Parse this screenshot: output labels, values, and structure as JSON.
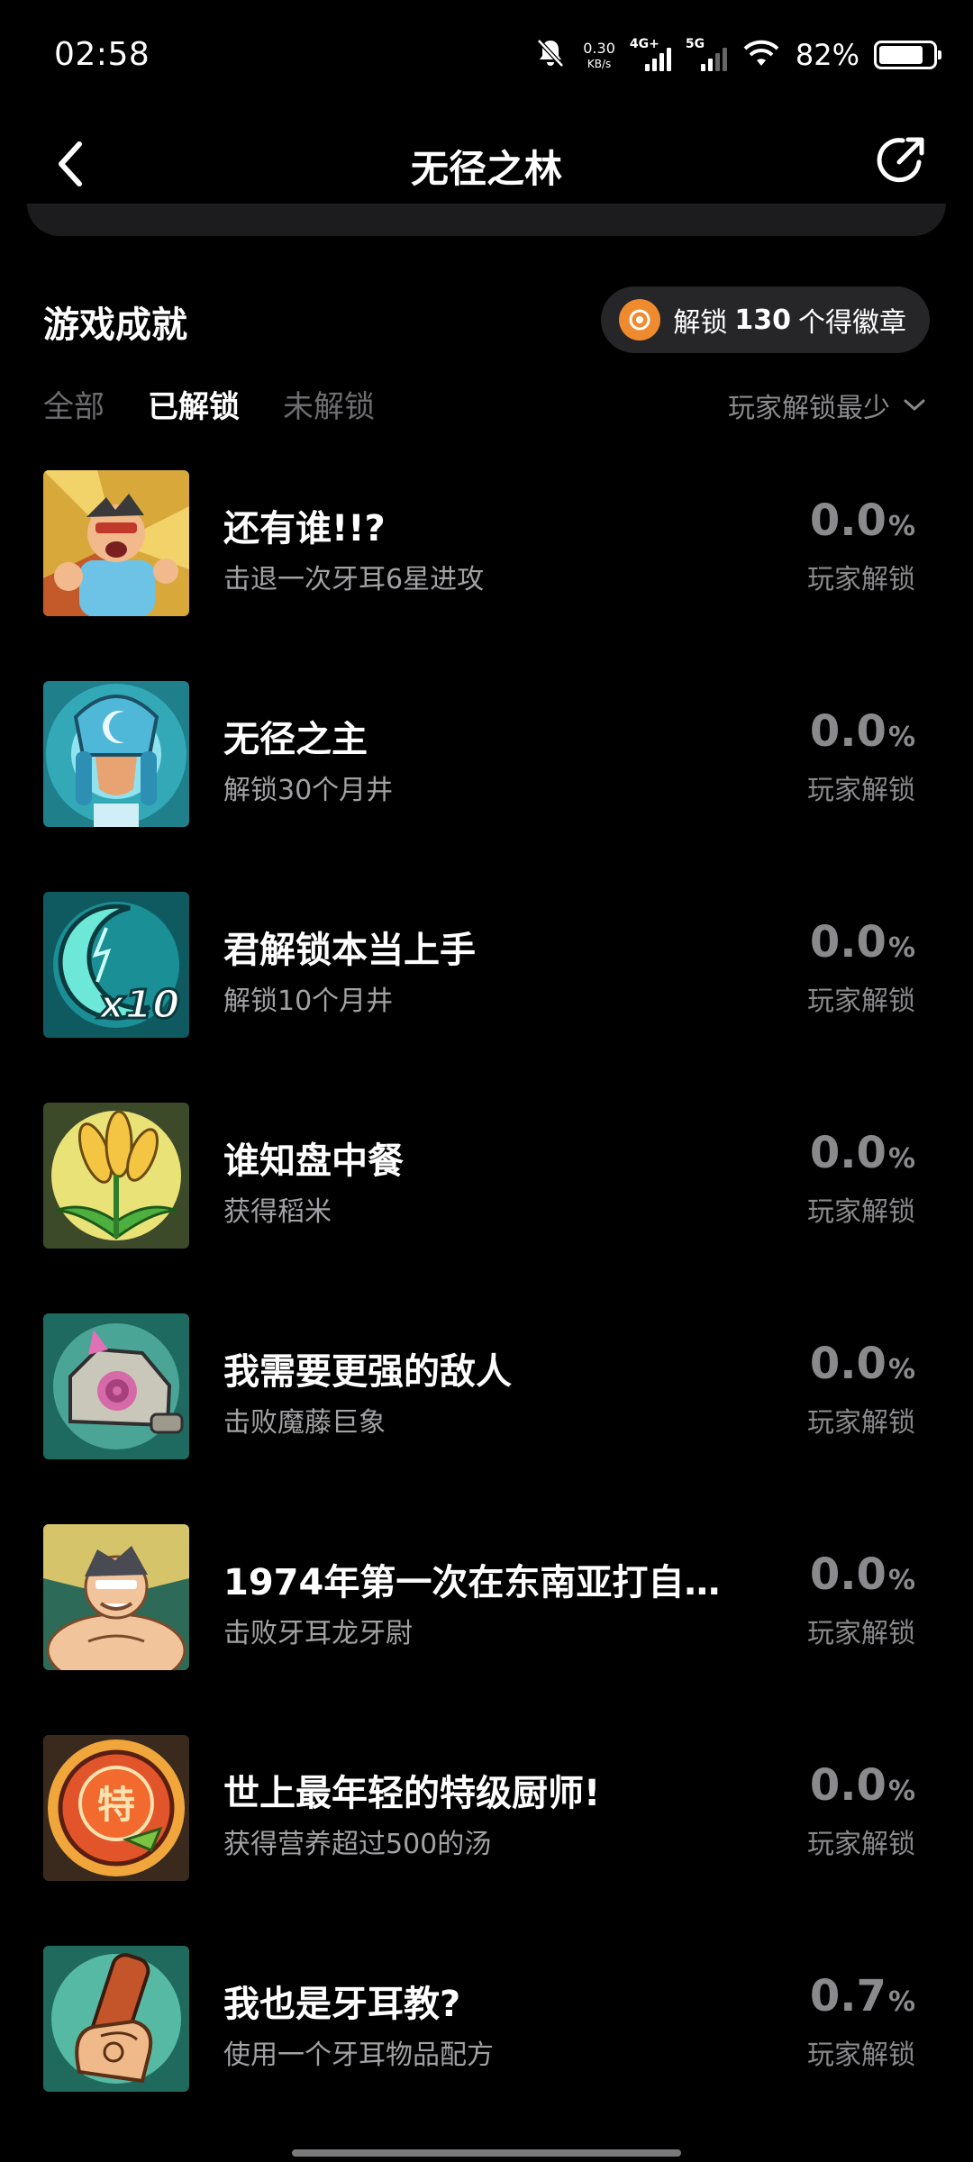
{
  "status_bar": {
    "time": "02:58",
    "net_speed": "0.30",
    "net_unit": "KB/s",
    "signal_1": "4G+",
    "signal_2": "5G",
    "battery_pct": "82%",
    "battery_level": 0.82,
    "icons": [
      "bell-muted-icon",
      "signal-icon",
      "wifi-icon",
      "battery-icon"
    ]
  },
  "nav": {
    "title": "无径之林",
    "back_icon": "chevron-left-icon",
    "share_icon": "share-icon"
  },
  "section": {
    "title": "游戏成就",
    "badge_prefix": "解锁",
    "badge_count": "130",
    "badge_suffix": "个得徽章"
  },
  "tabs": [
    {
      "label": "全部",
      "active": false
    },
    {
      "label": "已解锁",
      "active": true
    },
    {
      "label": "未解锁",
      "active": false
    }
  ],
  "sort": {
    "label": "玩家解锁最少",
    "icon": "chevron-down-icon"
  },
  "achievements": [
    {
      "title": "还有谁!!?",
      "desc": "击退一次牙耳6星进攻",
      "pct": "0.0",
      "pct_symbol": "%",
      "label": "玩家解锁",
      "icon": "shouting-hero-icon"
    },
    {
      "title": "无径之主",
      "desc": "解锁30个月井",
      "pct": "0.0",
      "pct_symbol": "%",
      "label": "玩家解锁",
      "icon": "moon-crown-icon"
    },
    {
      "title": "君解锁本当上手",
      "desc": "解锁10个月井",
      "pct": "0.0",
      "pct_symbol": "%",
      "label": "玩家解锁",
      "icon": "crescent-x10-icon"
    },
    {
      "title": "谁知盘中餐",
      "desc": "获得稻米",
      "pct": "0.0",
      "pct_symbol": "%",
      "label": "玩家解锁",
      "icon": "rice-plant-icon"
    },
    {
      "title": "我需要更强的敌人",
      "desc": "击败魔藤巨象",
      "pct": "0.0",
      "pct_symbol": "%",
      "label": "玩家解锁",
      "icon": "stone-golem-icon"
    },
    {
      "title": "1974年第一次在东南亚打自…",
      "desc": "击败牙耳龙牙尉",
      "pct": "0.0",
      "pct_symbol": "%",
      "label": "玩家解锁",
      "icon": "muscle-man-icon"
    },
    {
      "title": "世上最年轻的特级厨师!",
      "desc": "获得营养超过500的汤",
      "pct": "0.0",
      "pct_symbol": "%",
      "label": "玩家解锁",
      "icon": "special-chef-emblem-icon"
    },
    {
      "title": "我也是牙耳教?",
      "desc": "使用一个牙耳物品配方",
      "pct": "0.7",
      "pct_symbol": "%",
      "label": "玩家解锁",
      "icon": "scroll-in-hand-icon"
    }
  ],
  "colors": {
    "background": "#000000",
    "badge_orange": "#f08a2e",
    "muted_text": "#8a8a8d"
  }
}
